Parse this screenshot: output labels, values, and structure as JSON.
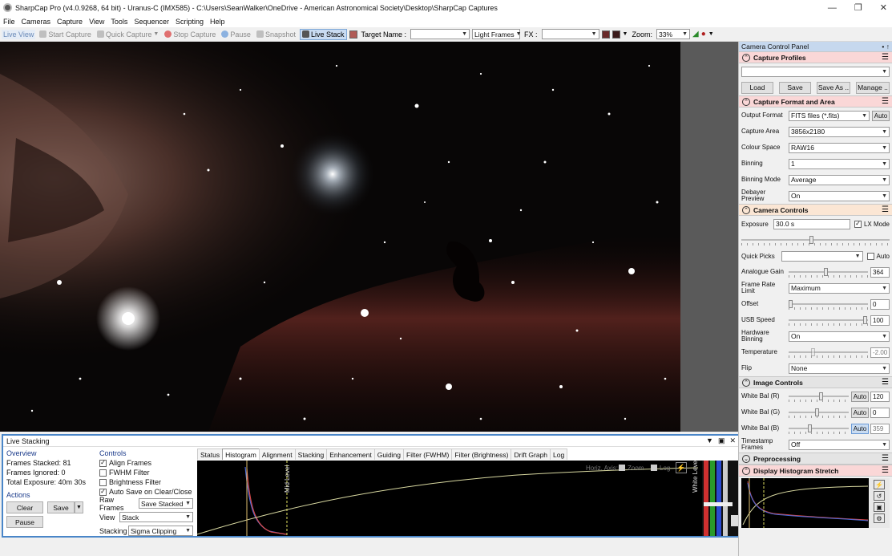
{
  "window": {
    "title": "SharpCap Pro (v4.0.9268, 64 bit) - Uranus-C (IMX585) - C:\\Users\\SeanWalker\\OneDrive - American Astronomical Society\\Desktop\\SharpCap Captures"
  },
  "menu": [
    "File",
    "Cameras",
    "Capture",
    "View",
    "Tools",
    "Sequencer",
    "Scripting",
    "Help"
  ],
  "toolbar": {
    "live_view": "Live View",
    "start_capture": "Start Capture",
    "quick_capture": "Quick Capture",
    "stop_capture": "Stop Capture",
    "pause": "Pause",
    "snapshot": "Snapshot",
    "live_stack": "Live Stack",
    "target_name_label": "Target Name :",
    "target_name_value": "",
    "frame_type": "Light Frames",
    "fx_label": "FX :",
    "fx_value": "",
    "zoom_label": "Zoom:",
    "zoom_value": "33%"
  },
  "live_stacking": {
    "title": "Live Stacking",
    "overview_heading": "Overview",
    "frames_stacked": "Frames Stacked: 81",
    "frames_ignored": "Frames Ignored: 0",
    "total_exposure": "Total Exposure:   40m 30s",
    "actions_heading": "Actions",
    "clear_label": "Clear",
    "save_label": "Save",
    "pause_label": "Pause",
    "controls_heading": "Controls",
    "checks": [
      {
        "label": "Align Frames",
        "checked": true
      },
      {
        "label": "FWHM Filter",
        "checked": false
      },
      {
        "label": "Brightness Filter",
        "checked": false
      },
      {
        "label": "Auto Save on Clear/Close",
        "checked": true
      }
    ],
    "raw_frames_label": "Raw Frames",
    "raw_frames_value": "Save Stacked",
    "view_label": "View",
    "view_value": "Stack",
    "stacking_label": "Stacking",
    "stacking_value": "Sigma Clipping",
    "tabs": [
      "Status",
      "Histogram",
      "Alignment",
      "Stacking",
      "Enhancement",
      "Guiding",
      "Filter (FWHM)",
      "Filter (Brightness)",
      "Drift Graph",
      "Log"
    ],
    "selected_tab": "Histogram",
    "hist_axis_label": "Horiz. Axis:",
    "hist_zoom": "Zoom",
    "hist_log": "Log",
    "mid_level": "Mid Level",
    "white_level": "White Level"
  },
  "panel": {
    "title": "Camera Control Panel",
    "pin": "• ↑",
    "capture_profiles": {
      "heading": "Capture Profiles",
      "load": "Load",
      "save": "Save",
      "save_as": "Save As ..",
      "manage": "Manage .."
    },
    "capture_format": {
      "heading": "Capture Format and Area",
      "output_format_label": "Output Format",
      "output_format_value": "FITS files (*.fits)",
      "auto": "Auto",
      "capture_area_label": "Capture Area",
      "capture_area_value": "3856x2180",
      "colour_space_label": "Colour Space",
      "colour_space_value": "RAW16",
      "binning_label": "Binning",
      "binning_value": "1",
      "binning_mode_label": "Binning Mode",
      "binning_mode_value": "Average",
      "debayer_label": "Debayer Preview",
      "debayer_value": "On"
    },
    "camera_controls": {
      "heading": "Camera Controls",
      "exposure_label": "Exposure",
      "exposure_value": "30.0 s",
      "lx_mode": "LX Mode",
      "quick_picks_label": "Quick Picks",
      "quick_picks_auto": "Auto",
      "gain_label": "Analogue Gain",
      "gain_value": "364",
      "frame_rate_label": "Frame Rate Limit",
      "frame_rate_value": "Maximum",
      "offset_label": "Offset",
      "offset_value": "0",
      "usb_label": "USB Speed",
      "usb_value": "100",
      "hw_binning_label": "Hardware Binning",
      "hw_binning_value": "On",
      "temperature_label": "Temperature",
      "temperature_value": "-2.00",
      "flip_label": "Flip",
      "flip_value": "None"
    },
    "image_controls": {
      "heading": "Image Controls",
      "wb_r_label": "White Bal (R)",
      "wb_r_auto": "Auto",
      "wb_r_value": "120",
      "wb_g_label": "White Bal (G)",
      "wb_g_auto": "Auto",
      "wb_g_value": "0",
      "wb_b_label": "White Bal (B)",
      "wb_b_auto": "Auto",
      "wb_b_value": "359",
      "timestamp_label": "Timestamp Frames",
      "timestamp_value": "Off"
    },
    "preprocessing": {
      "heading": "Preprocessing"
    },
    "histogram_stretch": {
      "heading": "Display Histogram Stretch"
    }
  },
  "colors": {
    "accent_blue": "#4a86c8",
    "panel_title": "#c6d8ee",
    "nebula_red": "#8a3a30"
  }
}
